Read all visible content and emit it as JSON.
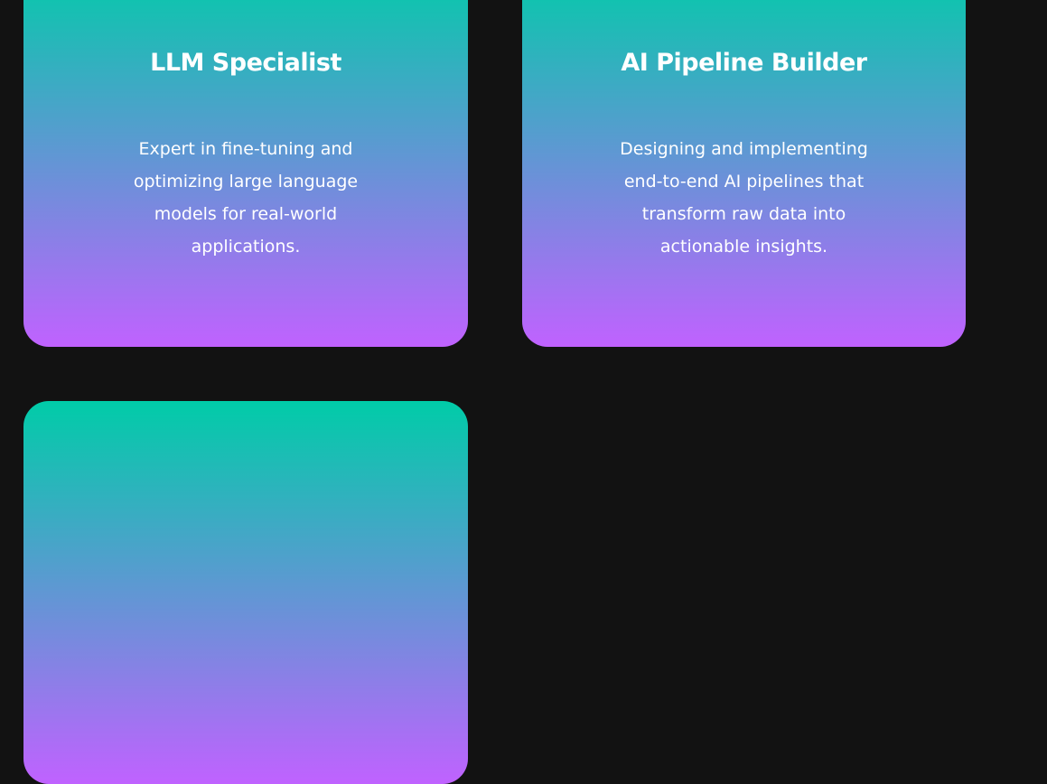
{
  "theme": {
    "background": "#121212",
    "gradient_top": "#00cca8",
    "gradient_bottom": "#c062ff"
  },
  "cards": [
    {
      "title": "LLM Specialist",
      "description": "Expert in fine-tuning and optimizing large language models for real-world applications."
    },
    {
      "title": "AI Pipeline Builder",
      "description": "Designing and implementing end-to-end AI pipelines that transform raw data into actionable insights."
    },
    {
      "title": "",
      "description": ""
    }
  ]
}
